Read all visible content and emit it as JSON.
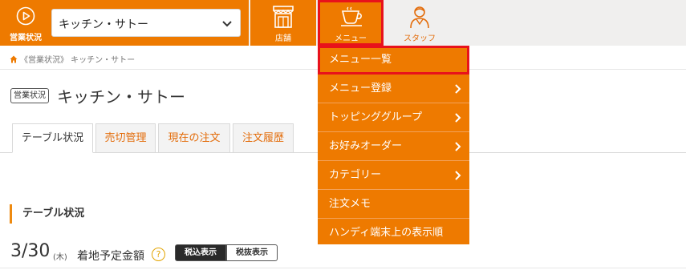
{
  "header": {
    "status_label": "営業状況",
    "store_select_value": "キッチン・サトー",
    "nav": {
      "store": "店舗",
      "menu": "メニュー",
      "staff": "スタッフ"
    }
  },
  "breadcrumb": "《営業状況》 キッチン・サトー",
  "title": {
    "badge": "営業状況",
    "name": "キッチン・サトー"
  },
  "tabs": [
    {
      "label": "テーブル状況",
      "active": true
    },
    {
      "label": "売切管理",
      "active": false
    },
    {
      "label": "現在の注文",
      "active": false
    },
    {
      "label": "注文履歴",
      "active": false
    }
  ],
  "section": {
    "heading": "テーブル状況",
    "date": "3/30",
    "weekday": "(木)",
    "amount_label": "着地予定金額",
    "help": "?",
    "toggle_tax_incl": "税込表示",
    "toggle_tax_excl": "税抜表示"
  },
  "dropdown": {
    "items": [
      {
        "label": "メニュー一覧",
        "has_submenu": false
      },
      {
        "label": "メニュー登録",
        "has_submenu": true
      },
      {
        "label": "トッピンググループ",
        "has_submenu": true
      },
      {
        "label": "お好みオーダー",
        "has_submenu": true
      },
      {
        "label": "カテゴリー",
        "has_submenu": true
      },
      {
        "label": "注文メモ",
        "has_submenu": false
      },
      {
        "label": "ハンディ端末上の表示順",
        "has_submenu": false
      }
    ]
  },
  "colors": {
    "accent_orange": "#ee7a00",
    "highlight_red": "#e8121b"
  }
}
